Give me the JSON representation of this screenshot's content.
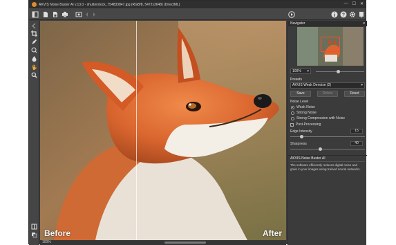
{
  "window": {
    "title": "AKVIS Noise Buster AI v.13.0 - shutterstock_754833847.jpg (RGB/8, 5472x3648) (DirectML)",
    "minimize": "—",
    "maximize": "☐",
    "close": "✕"
  },
  "canvas": {
    "before_label": "Before",
    "after_label": "After",
    "split_fraction": 0.39
  },
  "status": {
    "zoom": "100%"
  },
  "navigator": {
    "header": "Navigator",
    "zoom_value": "100%"
  },
  "presets": {
    "header": "Presets",
    "selected": "AKVIS Weak Denoise (2)",
    "save_label": "Save",
    "delete_label": "Delete",
    "reset_label": "Reset"
  },
  "settings": {
    "noise_level_label": "Noise Level",
    "options": [
      "Weak Noise",
      "Strong Noise",
      "Strong Compression with Noise"
    ],
    "selected_index": 0,
    "post_processing_label": "Post-Processing",
    "post_processing_checked": true,
    "edge_intensity_label": "Edge Intensity",
    "edge_intensity_value": "15",
    "edge_intensity_fraction": 0.15,
    "sharpness_label": "Sharpness",
    "sharpness_value": "40",
    "sharpness_fraction": 0.4
  },
  "about": {
    "header": "AKVIS Noise Buster AI",
    "text": "The software efficiently reduces digital noise and grain in your images using trained neural networks."
  },
  "colors": {
    "accent_orange": "#e4892c",
    "nav_selection": "#ff4a3a"
  }
}
